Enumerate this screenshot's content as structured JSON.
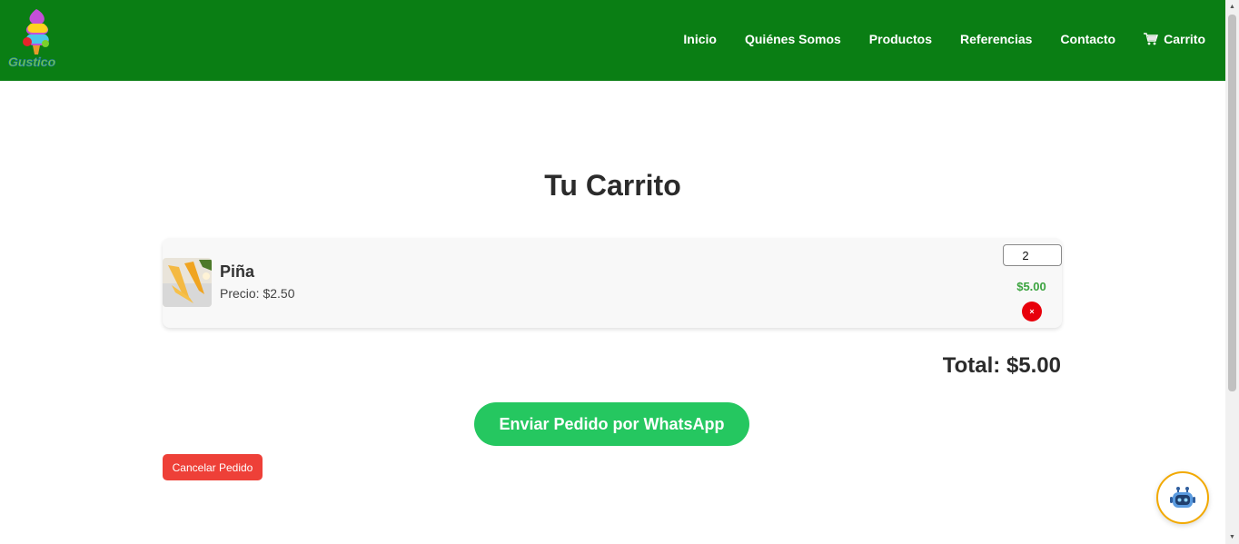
{
  "header": {
    "logo_text": "Gustico",
    "nav": [
      {
        "label": "Inicio"
      },
      {
        "label": "Quiénes Somos"
      },
      {
        "label": "Productos"
      },
      {
        "label": "Referencias"
      },
      {
        "label": "Contacto"
      },
      {
        "label": "Carrito",
        "icon": "cart-icon"
      }
    ]
  },
  "main": {
    "title": "Tu Carrito",
    "items": [
      {
        "name": "Piña",
        "price_label": "Precio: $2.50",
        "quantity": "2",
        "subtotal": "$5.00",
        "remove_symbol": "×"
      }
    ],
    "total_label": "Total: $5.00",
    "whatsapp_button": "Enviar Pedido por WhatsApp",
    "cancel_button": "Cancelar Pedido"
  },
  "chatbot": {
    "icon": "robot-icon"
  },
  "colors": {
    "header_bg": "#0a7e14",
    "whatsapp_green": "#25c760",
    "cancel_red": "#ee4038",
    "remove_red": "#e8000b",
    "subtotal_green": "#3ba33f",
    "bot_border": "#f2a900"
  }
}
